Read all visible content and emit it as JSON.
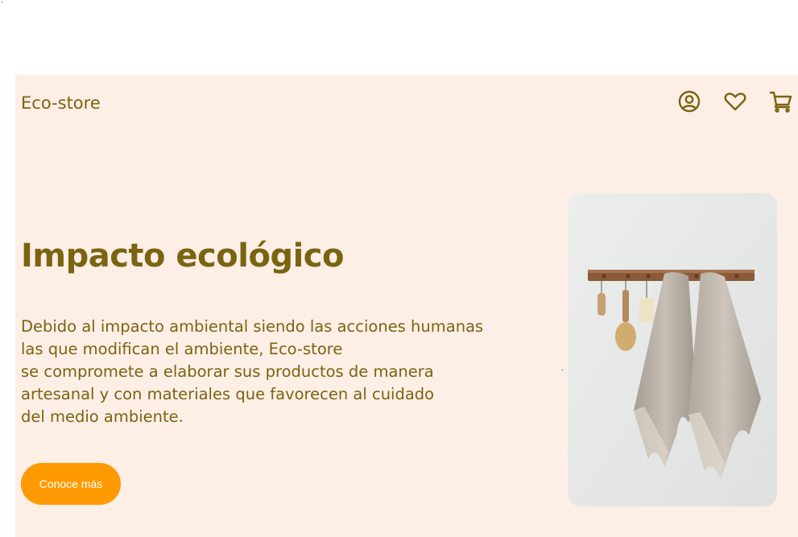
{
  "header": {
    "brand": "Eco-store",
    "icons": [
      "user-circle-icon",
      "heart-icon",
      "cart-icon"
    ]
  },
  "hero": {
    "title": "Impacto ecológico",
    "body_lines": [
      "Debido al impacto ambiental siendo las acciones humanas",
      "las que modifican el ambiente, Eco-store",
      "se compromete a elaborar sus productos de manera",
      "artesanal y con materiales que favorecen al cuidado",
      "del medio ambiente."
    ],
    "cta_label": "Conoce más",
    "image_subject": "towels-hanging-on-wooden-rack"
  },
  "colors": {
    "accent_text": "#7a6410",
    "section_bg": "#fdeee6",
    "cta_bg": "#ff9a02",
    "cta_text": "#ffffff"
  }
}
